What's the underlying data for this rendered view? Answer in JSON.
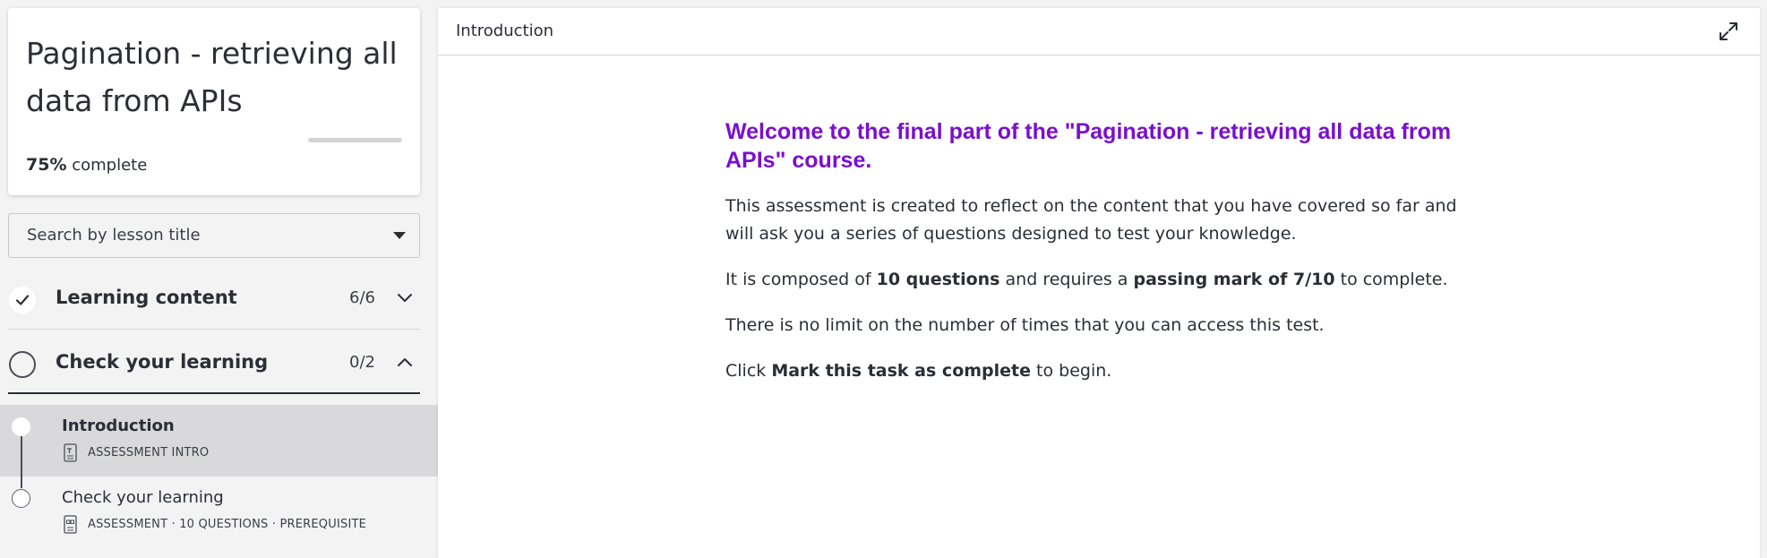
{
  "course": {
    "title": "Pagination - retrieving all data from APIs",
    "progress_value": "75%",
    "progress_suffix": "complete",
    "progress_fraction": 0.75
  },
  "search": {
    "placeholder": "Search by lesson title"
  },
  "sections": [
    {
      "label": "Learning content",
      "count": "6/6",
      "status": "complete",
      "expanded": false
    },
    {
      "label": "Check your learning",
      "count": "0/2",
      "status": "incomplete",
      "expanded": true
    }
  ],
  "lessons": [
    {
      "name": "Introduction",
      "meta": "ASSESSMENT INTRO",
      "selected": true
    },
    {
      "name": "Check your learning",
      "meta": "ASSESSMENT · 10 QUESTIONS · PREREQUISITE",
      "selected": false
    }
  ],
  "main": {
    "header_title": "Introduction",
    "heading": "Welcome to the final part of the \"Pagination - retrieving all data from APIs\" course.",
    "p1": "This assessment is created to reflect on the content that you have covered so far and will ask you a series of questions designed to test your knowledge.",
    "p2_a": "It is composed of ",
    "p2_b": "10 questions",
    "p2_c": " and requires a ",
    "p2_d": "passing mark of 7/10",
    "p2_e": " to complete.",
    "p3": "There is no limit on the number of times that you can access this test.",
    "p4_a": "Click ",
    "p4_b": "Mark this task as complete",
    "p4_c": " to begin."
  },
  "icons": {
    "check": "check-icon",
    "expand": "expand-icon",
    "chevron_down": "chevron-down-icon",
    "chevron_up": "chevron-up-icon"
  },
  "colors": {
    "heading": "#7a0fcf",
    "selected_row": "#d9d9db",
    "background": "#f3f3f4"
  }
}
